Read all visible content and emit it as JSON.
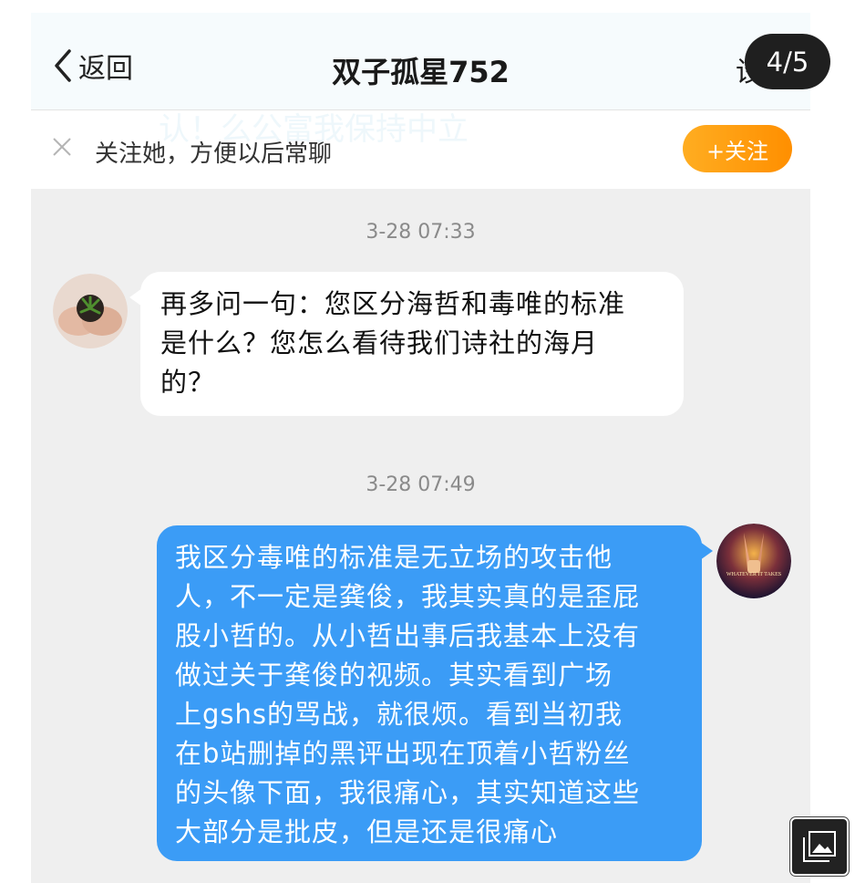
{
  "header": {
    "back_label": "返回",
    "title": "双子孤星752",
    "settings_label": "设置",
    "background_overlay_text": "认！么公富我保持中立"
  },
  "follow_prompt": {
    "text": "关注她，方便以后常聊",
    "button_label": "+关注"
  },
  "messages": [
    {
      "timestamp": "3-28 07:33",
      "sender": "other",
      "lines": [
        "再多问一句：您区分海哲和毒唯的标准",
        "是什么？您怎么看待我们诗社的海月",
        "的？"
      ]
    },
    {
      "timestamp": "3-28 07:49",
      "sender": "self",
      "avatar_caption": "WHATEVER IT TAKES",
      "lines": [
        "我区分毒唯的标准是无立场的攻击他",
        "人，不一定是龚俊，我其实真的是歪屁",
        "股小哲的。从小哲出事后我基本上没有",
        "做过关于龚俊的视频。其实看到广场",
        "上gshs的骂战，就很烦。看到当初我",
        "在b站删掉的黑评出现在顶着小哲粉丝",
        "的头像下面，我很痛心，其实知道这些",
        "大部分是批皮，但是还是很痛心"
      ]
    }
  ],
  "viewer": {
    "page_indicator": "4/5",
    "gallery_icon": "gallery-icon"
  },
  "colors": {
    "self_bubble": "#3b9cf6",
    "follow_button": "#ff9a0e",
    "chat_background": "#efefef"
  }
}
